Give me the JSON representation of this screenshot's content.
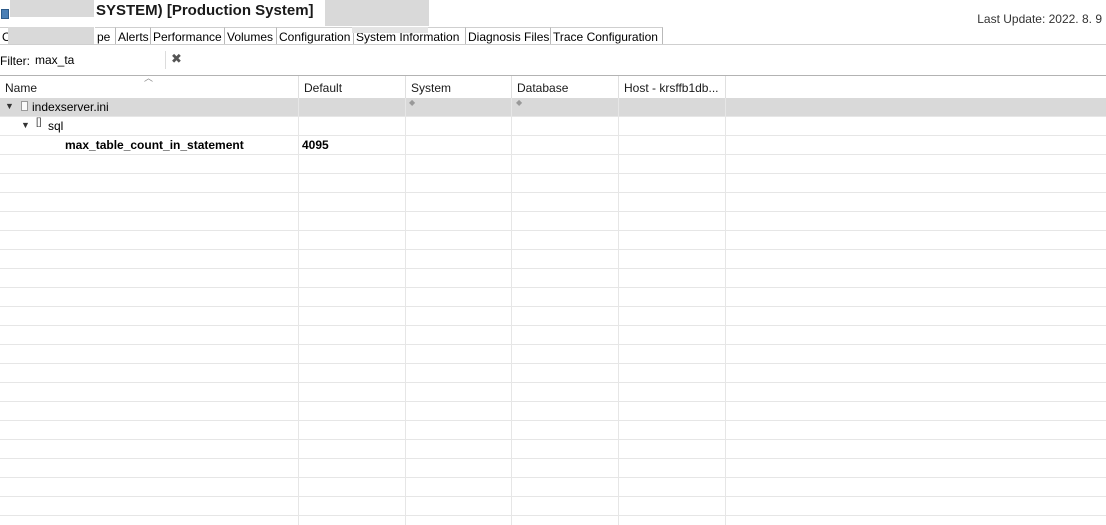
{
  "window": {
    "title": "SYSTEM) [Production System]",
    "last_update": "Last Update: 2022. 8. 9"
  },
  "tabs": [
    "O",
    "pe",
    "Alerts",
    "Performance",
    "Volumes",
    "Configuration",
    "System Information",
    "Diagnosis Files",
    "Trace Configuration"
  ],
  "filter": {
    "label": "Filter:",
    "value": "max_ta"
  },
  "columns": {
    "name": "Name",
    "default": "Default",
    "system": "System",
    "database": "Database",
    "host": "Host - krsffb1db..."
  },
  "tree": {
    "ini_file": {
      "name": "indexserver.ini",
      "system_marker": "◆",
      "database_marker": "◆"
    },
    "section": {
      "name": "sql"
    },
    "parameter": {
      "name": "max_table_count_in_statement",
      "default": "4095"
    }
  },
  "icons": {
    "clear": "close-icon",
    "expand": "chevron-down-icon",
    "file": "file-icon",
    "section": "section-icon",
    "sort": "sort-caret-icon"
  }
}
